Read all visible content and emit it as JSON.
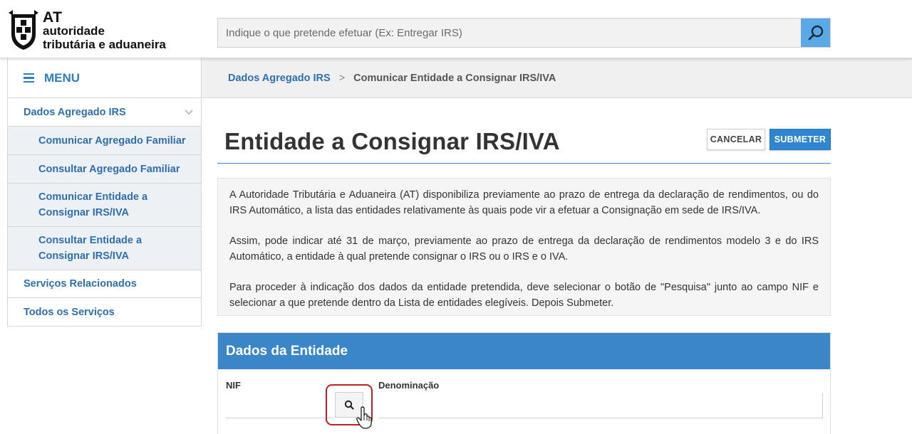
{
  "header": {
    "logo": {
      "at": "AT",
      "line1": "autoridade",
      "line2": "tributária e aduaneira"
    },
    "search": {
      "placeholder": "Indique o que pretende efetuar (Ex: Entregar IRS)",
      "value": "",
      "icon": "search-icon"
    }
  },
  "sidebar": {
    "menu_label": "MENU",
    "menu_icon": "hamburger-icon",
    "items": [
      {
        "label": "Dados Agregado IRS",
        "expanded": true,
        "icon": "chevron-down-icon"
      },
      {
        "label": "Comunicar Agregado Familiar"
      },
      {
        "label": "Consultar Agregado Familiar"
      },
      {
        "label": "Comunicar Entidade a Consignar IRS/IVA"
      },
      {
        "label": "Consultar Entidade a Consignar IRS/IVA"
      },
      {
        "label": "Serviços Relacionados"
      },
      {
        "label": "Todos os Serviços"
      }
    ]
  },
  "breadcrumb": {
    "parent": "Dados Agregado IRS",
    "separator": ">",
    "current": "Comunicar Entidade a Consignar IRS/IVA"
  },
  "page": {
    "title": "Entidade a Consignar IRS/IVA",
    "cancel_label": "CANCELAR",
    "submit_label": "SUBMETER"
  },
  "info": {
    "p1": "A Autoridade Tributária e Aduaneira (AT) disponibiliza previamente ao prazo de entrega da declaração de rendimentos, ou do IRS Automático, a lista das entidades relativamente às quais pode vir a efetuar a Consignação em sede de IRS/IVA.",
    "p2": "Assim, pode indicar até 31 de março, previamente ao prazo de entrega da declaração de rendimentos modelo 3 e do IRS Automático, a entidade à qual pretende consignar o IRS ou o IRS e o IVA.",
    "p3": "Para proceder à indicação dos dados da entidade pretendida, deve selecionar o botão de \"Pesquisa\" junto ao campo NIF e selecionar a que pretende dentro da Lista de entidades elegíveis. Depois Submeter."
  },
  "entity_panel": {
    "title": "Dados da Entidade",
    "nif_label": "NIF",
    "nif_value": "",
    "denominacao_label": "Denominação",
    "denominacao_value": ""
  },
  "colors": {
    "accent": "#3a86c8",
    "link": "#2e6fb0",
    "search_button": "#5aa9e6",
    "highlight": "#c01f1f"
  }
}
